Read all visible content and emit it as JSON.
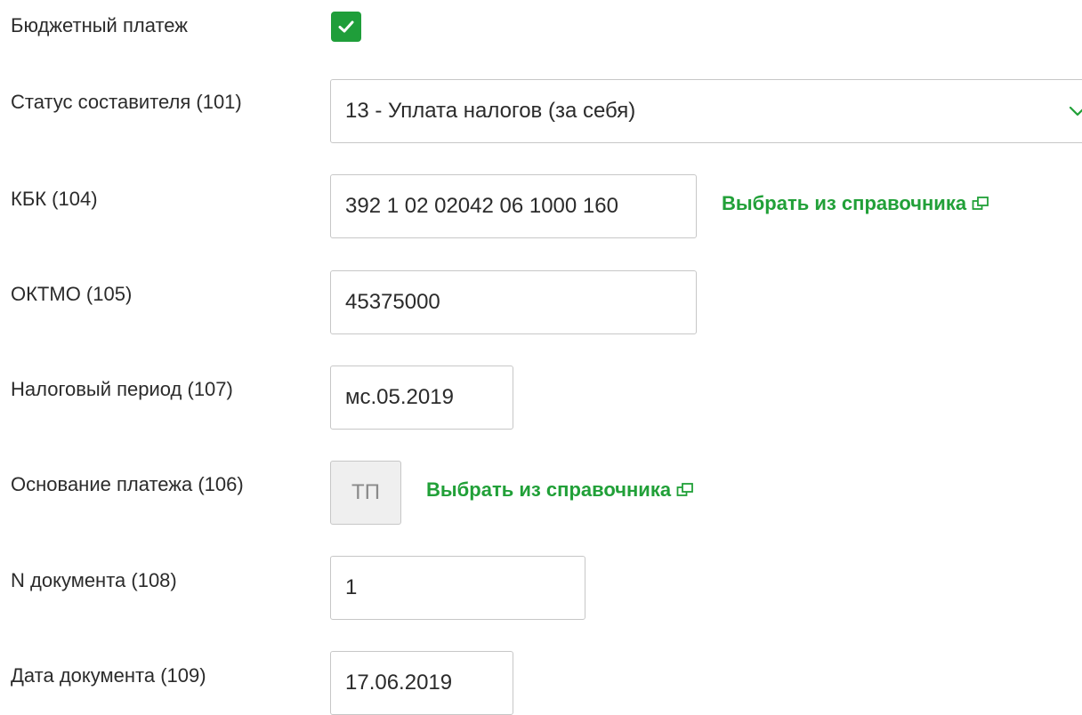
{
  "colors": {
    "accent_green": "#21a038",
    "checkbox_green": "#1f9e3a",
    "field_border": "#c7c7c7",
    "disabled_bg": "#efefef"
  },
  "budget_payment": {
    "label": "Бюджетный платеж",
    "checked": true
  },
  "composer_status": {
    "label": "Статус составителя (101)",
    "selected": "13 - Уплата налогов (за себя)"
  },
  "kbk": {
    "label": "КБК (104)",
    "value": "392 1 02 02042 06 1000 160",
    "link": "Выбрать из справочника"
  },
  "oktmo": {
    "label": "ОКТМО (105)",
    "value": "45375000"
  },
  "tax_period": {
    "label": "Налоговый период (107)",
    "value": "мс.05.2019"
  },
  "payment_basis": {
    "label": "Основание платежа (106)",
    "value": "ТП",
    "link": "Выбрать из справочника"
  },
  "doc_number": {
    "label": "N документа (108)",
    "value": "1"
  },
  "doc_date": {
    "label": "Дата документа (109)",
    "value": "17.06.2019"
  }
}
